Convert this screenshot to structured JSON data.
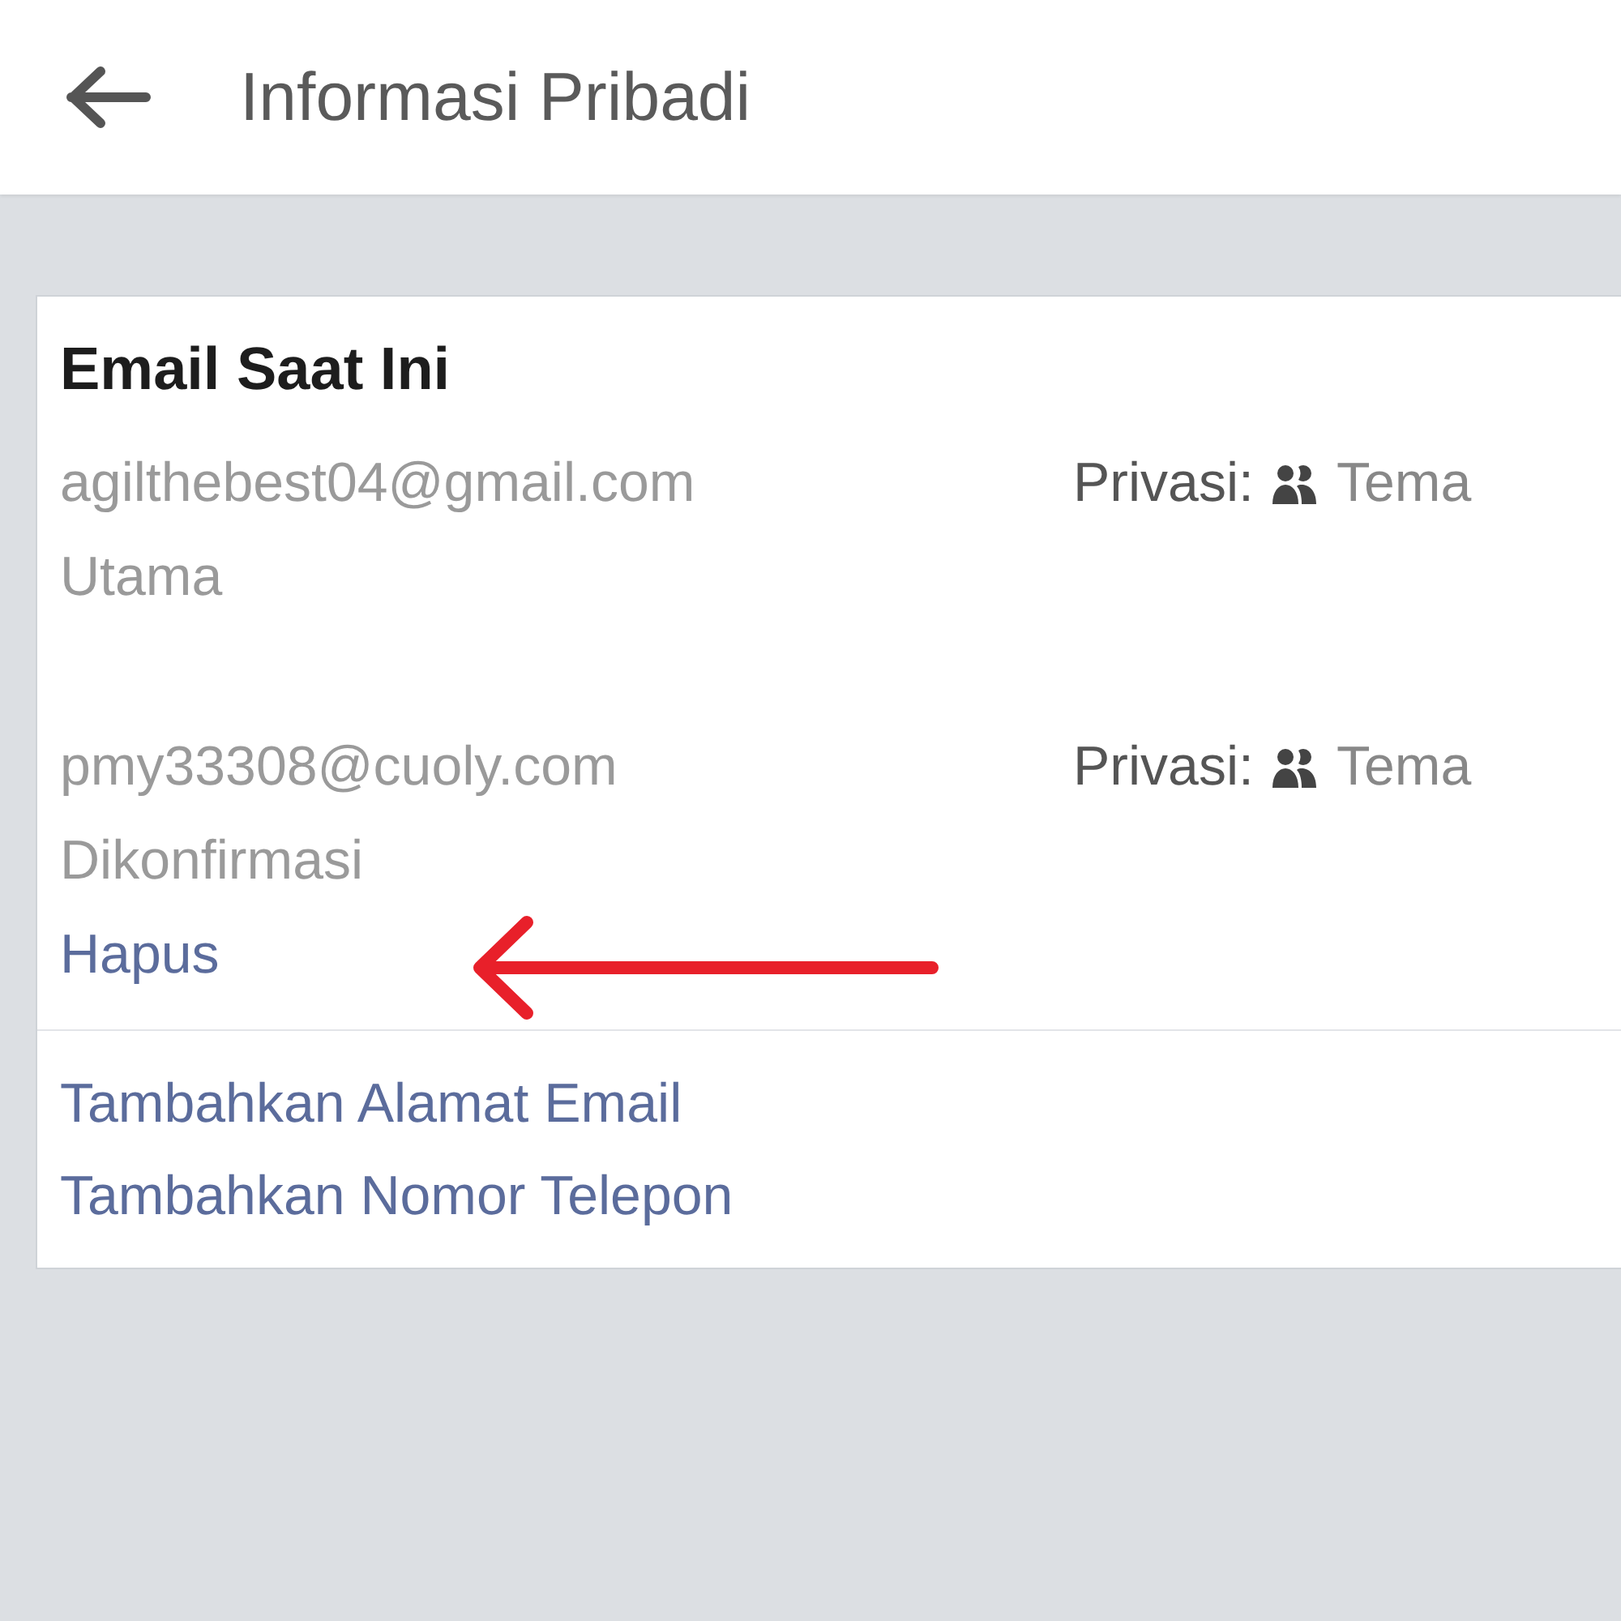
{
  "header": {
    "title": "Informasi Pribadi"
  },
  "section": {
    "title": "Email Saat Ini",
    "emails": [
      {
        "address": "agilthebest04@gmail.com",
        "status": "Utama",
        "privacy_label": "Privasi:",
        "privacy_value": "Tema"
      },
      {
        "address": "pmy33308@cuoly.com",
        "status": "Dikonfirmasi",
        "action": "Hapus",
        "privacy_label": "Privasi:",
        "privacy_value": "Tema"
      }
    ],
    "links": [
      "Tambahkan Alamat Email",
      "Tambahkan Nomor Telepon"
    ]
  },
  "annotation": {
    "kind": "arrow"
  }
}
